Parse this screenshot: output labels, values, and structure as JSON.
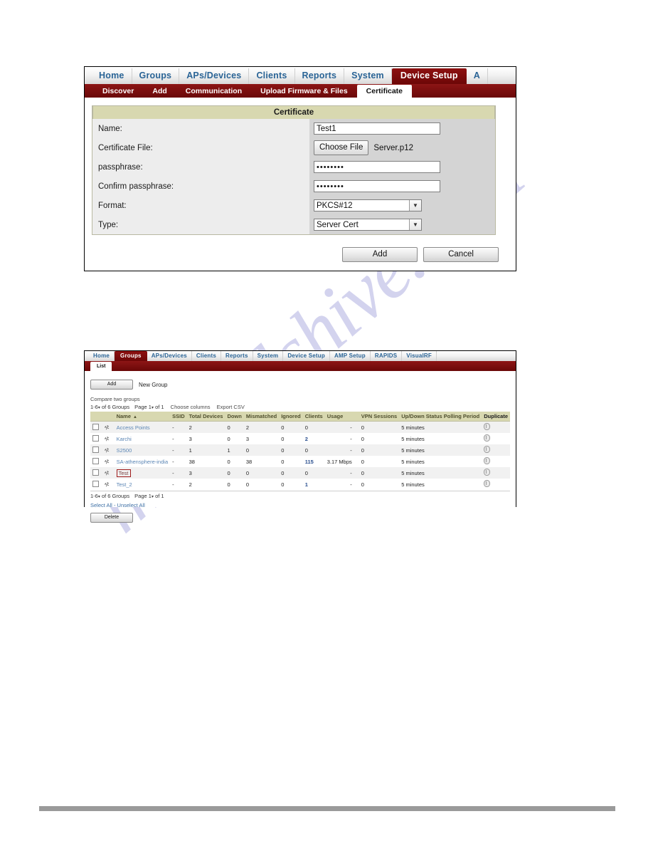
{
  "watermark": {
    "text": "manualshive.com"
  },
  "certificate_screenshot": {
    "main_nav": [
      {
        "label": "Home",
        "active": false
      },
      {
        "label": "Groups",
        "active": false
      },
      {
        "label": "APs/Devices",
        "active": false
      },
      {
        "label": "Clients",
        "active": false
      },
      {
        "label": "Reports",
        "active": false
      },
      {
        "label": "System",
        "active": false
      },
      {
        "label": "Device Setup",
        "active": true
      },
      {
        "label": "A",
        "active": false
      }
    ],
    "sub_nav": [
      {
        "label": "Discover",
        "active": false
      },
      {
        "label": "Add",
        "active": false
      },
      {
        "label": "Communication",
        "active": false
      },
      {
        "label": "Upload Firmware & Files",
        "active": false
      },
      {
        "label": "Certificate",
        "active": true
      }
    ],
    "panel_title": "Certificate",
    "fields": [
      {
        "label": "Name:",
        "type": "text",
        "value": "Test1"
      },
      {
        "label": "Certificate File:",
        "type": "file",
        "button": "Choose File",
        "value": "Server.p12"
      },
      {
        "label": "passphrase:",
        "type": "password",
        "value": "••••••••"
      },
      {
        "label": "Confirm passphrase:",
        "type": "password",
        "value": "••••••••"
      },
      {
        "label": "Format:",
        "type": "select",
        "value": "PKCS#12"
      },
      {
        "label": "Type:",
        "type": "select",
        "value": "Server Cert"
      }
    ],
    "buttons": {
      "add": "Add",
      "cancel": "Cancel"
    }
  },
  "groups_screenshot": {
    "main_nav": [
      {
        "label": "Home",
        "active": false
      },
      {
        "label": "Groups",
        "active": true
      },
      {
        "label": "APs/Devices",
        "active": false
      },
      {
        "label": "Clients",
        "active": false
      },
      {
        "label": "Reports",
        "active": false
      },
      {
        "label": "System",
        "active": false
      },
      {
        "label": "Device Setup",
        "active": false
      },
      {
        "label": "AMP Setup",
        "active": false
      },
      {
        "label": "RAPIDS",
        "active": false
      },
      {
        "label": "VisualRF",
        "active": false
      }
    ],
    "sub_nav": [
      {
        "label": "List",
        "active": true
      }
    ],
    "add_button": "Add",
    "add_caption": "New Group",
    "compare_link": "Compare two groups",
    "meta_top": {
      "range": "1-6",
      "of_groups": "of 6 Groups",
      "page_label": "Page",
      "page_num": "1",
      "page_of": "of 1",
      "choose_columns": "Choose columns",
      "export_csv": "Export CSV"
    },
    "meta_bottom": {
      "range": "1-6",
      "of_groups": "of 6 Groups",
      "page_label": "Page",
      "page_num": "1",
      "page_of": "of 1"
    },
    "columns": [
      "Name",
      "SSID",
      "Total Devices",
      "Down",
      "Mismatched",
      "Ignored",
      "Clients",
      "Usage",
      "VPN Sessions",
      "Up/Down Status Polling Period",
      "Duplicate"
    ],
    "sort_column": "Name",
    "sort_direction": "asc",
    "rows": [
      {
        "name": "Access Points",
        "highlighted": false,
        "ssid": "-",
        "total_devices": "2",
        "down": "0",
        "mismatched": "2",
        "ignored": "0",
        "clients": "0",
        "clients_bold": false,
        "usage": "-",
        "vpn_sessions": "0",
        "polling": "5 minutes"
      },
      {
        "name": "Karchi",
        "highlighted": false,
        "ssid": "-",
        "total_devices": "3",
        "down": "0",
        "mismatched": "3",
        "ignored": "0",
        "clients": "2",
        "clients_bold": true,
        "usage": "-",
        "vpn_sessions": "0",
        "polling": "5 minutes"
      },
      {
        "name": "S2500",
        "highlighted": false,
        "ssid": "-",
        "total_devices": "1",
        "down": "1",
        "mismatched": "0",
        "ignored": "0",
        "clients": "0",
        "clients_bold": false,
        "usage": "-",
        "vpn_sessions": "0",
        "polling": "5 minutes"
      },
      {
        "name": "SA-athensphere-india",
        "highlighted": false,
        "ssid": "-",
        "total_devices": "38",
        "down": "0",
        "mismatched": "38",
        "ignored": "0",
        "clients": "115",
        "clients_bold": true,
        "usage": "3.17 Mbps",
        "vpn_sessions": "0",
        "polling": "5 minutes"
      },
      {
        "name": "Test",
        "highlighted": true,
        "ssid": "-",
        "total_devices": "3",
        "down": "0",
        "mismatched": "0",
        "ignored": "0",
        "clients": "0",
        "clients_bold": false,
        "usage": "-",
        "vpn_sessions": "0",
        "polling": "5 minutes"
      },
      {
        "name": "Test_2",
        "highlighted": false,
        "ssid": "-",
        "total_devices": "2",
        "down": "0",
        "mismatched": "0",
        "ignored": "0",
        "clients": "1",
        "clients_bold": true,
        "usage": "-",
        "vpn_sessions": "0",
        "polling": "5 minutes"
      }
    ],
    "select_all": "Select All",
    "unselect_all": "Unselect All",
    "select_separator": "-",
    "delete_button": "Delete"
  },
  "colors": {
    "nav_active_red": "#7c0d0d",
    "subnav_red": "#7b0f0f",
    "panel_header_khaki": "#d8d8b0",
    "link_blue": "#3d6fa5",
    "highlight_box_red": "#9e1b1b",
    "watermark_lavender": "#d3d3ee"
  }
}
